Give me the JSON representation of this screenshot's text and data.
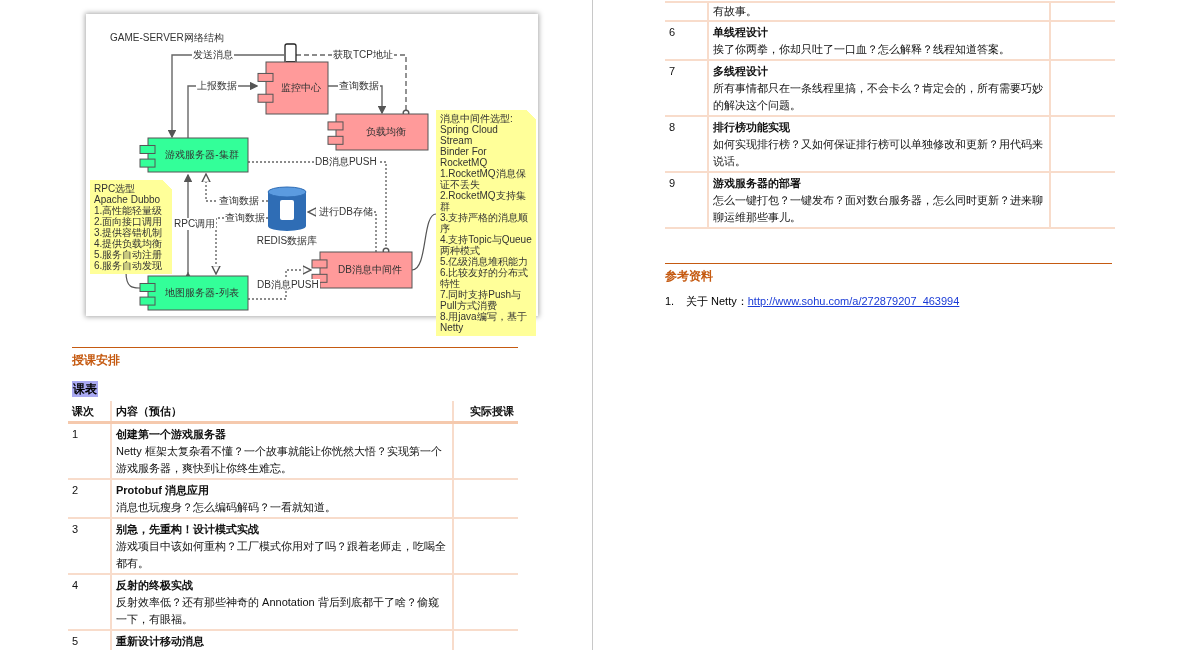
{
  "diagram": {
    "title": "GAME-SERVER网络结构",
    "nodes": [
      {
        "kind": "component",
        "label": "监控中心",
        "color": "#ff9a9a"
      },
      {
        "kind": "component",
        "label": "负载均衡",
        "color": "#ff9a9a"
      },
      {
        "kind": "component",
        "label": "游戏服务器-集群",
        "color": "#33ff99"
      },
      {
        "kind": "component",
        "label": "地图服务器-列表",
        "color": "#33ff99"
      },
      {
        "kind": "component",
        "label": "DB消息中间件",
        "color": "#ff9a9a"
      },
      {
        "kind": "database",
        "label": "REDIS数据库"
      }
    ],
    "notes": [
      {
        "lines": [
          "RPC选型",
          "Apache Dubbo",
          "1.高性能轻量级",
          "2.面向接口调用",
          "3.提供容错机制",
          "4.提供负载均衡",
          "5.服务自动注册",
          "6.服务自动发现"
        ]
      },
      {
        "lines": [
          "消息中间件选型:",
          "Spring Cloud Stream",
          "Binder For RocketMQ",
          "1.RocketMQ消息保证不丢失",
          "2.RocketMQ支持集群",
          "3.支持严格的消息顺序",
          "4.支持Topic与Queue两种模式",
          "5.亿级消息堆积能力",
          "6.比较友好的分布式特性",
          "7.同时支持Push与Pull方式消费",
          "8.用java编写，基于Netty"
        ]
      }
    ],
    "edge_labels": [
      "发送消息",
      "获取TCP地址",
      "上报数据",
      "查询数据",
      "DB消息PUSH",
      "RPC调用",
      "查询数据",
      "查询数据",
      "进行DB存储",
      "DB消息PUSH"
    ]
  },
  "left_page": {
    "section_title": "授课安排",
    "subtitle": {
      "text": "课表",
      "highlighted": true
    },
    "table": {
      "columns": [
        "课次",
        "内容（预估）",
        "实际授课"
      ],
      "rows": [
        {
          "number": "1",
          "title": "创建第一个游戏服务器",
          "description": "Netty 框架太复杂看不懂？一个故事就能让你恍然大悟？实现第一个游戏服务器，爽快到让你终生难忘。"
        },
        {
          "number": "2",
          "title": "Protobuf 消息应用",
          "description": "消息也玩瘦身？怎么编码解码？一看就知道。"
        },
        {
          "number": "3",
          "title": "别急，先重构！设计模式实战",
          "description": "游戏项目中该如何重构？工厂模式你用对了吗？跟着老师走，吃喝全都有。"
        },
        {
          "number": "4",
          "title": "反射的终极实战",
          "description": "反射效率低？还有那些神奇的 Annotation 背后到底都干了啥？偷窥一下，有眼福。"
        },
        {
          "number": "5",
          "title": "重新设计移动消息"
        }
      ]
    }
  },
  "right_page": {
    "table": {
      "rows": [
        {
          "kind": "continuation",
          "description": "有故事。"
        },
        {
          "number": "6",
          "title": "单线程设计",
          "description": "挨了你两拳，你却只吐了一口血？怎么解释？线程知道答案。"
        },
        {
          "number": "7",
          "title": "多线程设计",
          "description": "所有事情都只在一条线程里搞，不会卡么？肯定会的，所有需要巧妙的解决这个问题。"
        },
        {
          "number": "8",
          "title": "排行榜功能实现",
          "description": "如何实现排行榜？又如何保证排行榜可以单独修改和更新？用代码来说话。"
        },
        {
          "number": "9",
          "title": "游戏服务器的部署",
          "description": "怎么一键打包？一键发布？面对数台服务器，怎么同时更新？进来聊聊运维那些事儿。"
        }
      ]
    },
    "references": {
      "title": "参考资料",
      "items": [
        {
          "number": "1.",
          "text": "关于 Netty：",
          "link": "http://www.sohu.com/a/272879207_463994"
        }
      ]
    }
  }
}
